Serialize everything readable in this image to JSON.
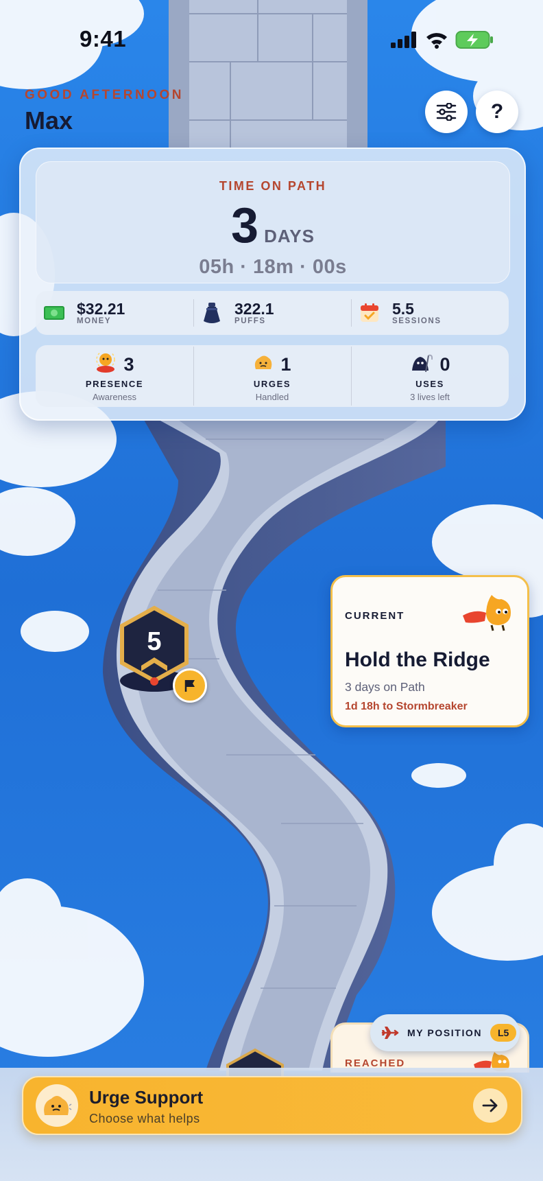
{
  "status_bar": {
    "time": "9:41"
  },
  "header": {
    "greeting": "GOOD AFTERNOON",
    "username": "Max",
    "settings_icon": "sliders-icon",
    "help_label": "?"
  },
  "time_on_path": {
    "label": "TIME ON PATH",
    "days": "3",
    "days_unit": "DAYS",
    "hms": "05h · 18m · 00s"
  },
  "metrics": [
    {
      "icon": "money-icon",
      "value": "$32.21",
      "label": "MONEY"
    },
    {
      "icon": "pouch-icon",
      "value": "322.1",
      "label": "PUFFS"
    },
    {
      "icon": "calendar-check-icon",
      "value": "5.5",
      "label": "SESSIONS"
    }
  ],
  "milestones": [
    {
      "icon": "meditating-mascot-icon",
      "count": "3",
      "title": "PRESENCE",
      "subtitle": "Awareness"
    },
    {
      "icon": "urge-blob-icon",
      "count": "1",
      "title": "URGES",
      "subtitle": "Handled"
    },
    {
      "icon": "reaper-icon",
      "count": "0",
      "title": "USES",
      "subtitle": "3 lives left"
    }
  ],
  "map": {
    "level_badge": "5",
    "flag_icon": "flag-icon"
  },
  "current_card": {
    "label": "CURRENT",
    "title": "Hold the Ridge",
    "days_on_path": "3 days on Path",
    "next_milestone": "1d 18h to Stormbreaker"
  },
  "reached_card": {
    "label": "REACHED"
  },
  "my_position": {
    "label": "MY POSITION",
    "level": "L5"
  },
  "urge_support": {
    "title": "Urge Support",
    "subtitle": "Choose what helps"
  },
  "colors": {
    "accent": "#b5462f",
    "amber": "#f8b42e",
    "navy": "#161b33",
    "sky": "#2b7fe0"
  }
}
